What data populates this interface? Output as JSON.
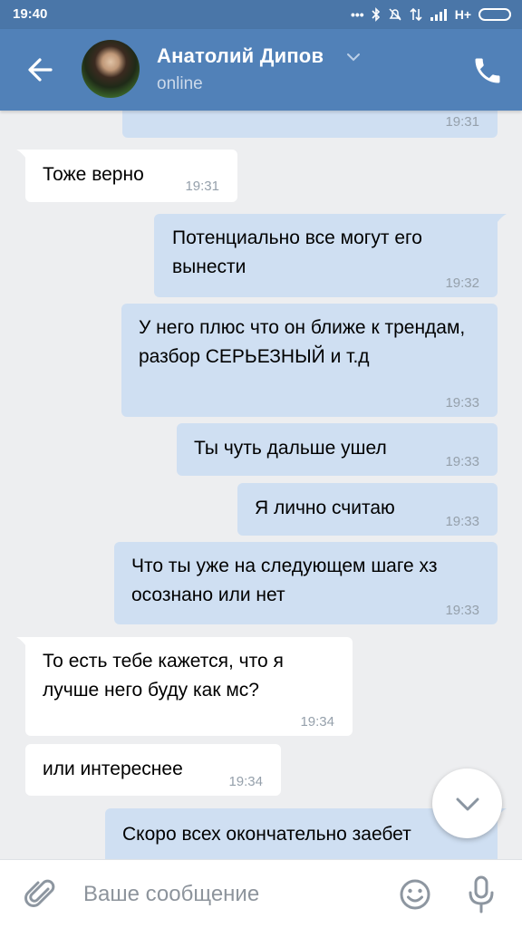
{
  "status_bar": {
    "time": "19:40",
    "network": "H+"
  },
  "header": {
    "back_icon": "arrow-left-icon",
    "contact_name": "Анатолий Дипов",
    "contact_status": "online",
    "call_icon": "phone-icon"
  },
  "messages": [
    {
      "dir": "out",
      "text": "",
      "time": "19:31"
    },
    {
      "dir": "in",
      "text": "Тоже верно",
      "time": "19:31"
    },
    {
      "dir": "out",
      "text": "Потенциально все могут его вынести",
      "time": "19:32"
    },
    {
      "dir": "out",
      "text": "У него плюс что он ближе к трендам, разбор СЕРЬЕЗНЫЙ и т.д",
      "time": "19:33"
    },
    {
      "dir": "out",
      "text": "Ты чуть дальше ушел",
      "time": "19:33"
    },
    {
      "dir": "out",
      "text": "Я лично считаю",
      "time": "19:33"
    },
    {
      "dir": "out",
      "text": "Что ты уже на следующем шаге хз осознано или нет",
      "time": "19:33"
    },
    {
      "dir": "in",
      "text": "То есть тебе кажется, что я лучше него буду как мс?",
      "time": "19:34"
    },
    {
      "dir": "in",
      "text": "или интереснее",
      "time": "19:34"
    },
    {
      "dir": "out",
      "text": "Скоро всех окончательно заебет",
      "time": ""
    }
  ],
  "input": {
    "placeholder": "Ваше сообщение",
    "value": ""
  },
  "icons": {
    "attach": "paperclip-icon",
    "emoji": "smile-icon",
    "mic": "microphone-icon",
    "scroll_down": "chevron-down-icon"
  },
  "colors": {
    "header": "#5181b8",
    "status_bar": "#4a76a8",
    "outgoing_bubble": "#cfdff2",
    "incoming_bubble": "#ffffff",
    "background": "#edeef0"
  }
}
